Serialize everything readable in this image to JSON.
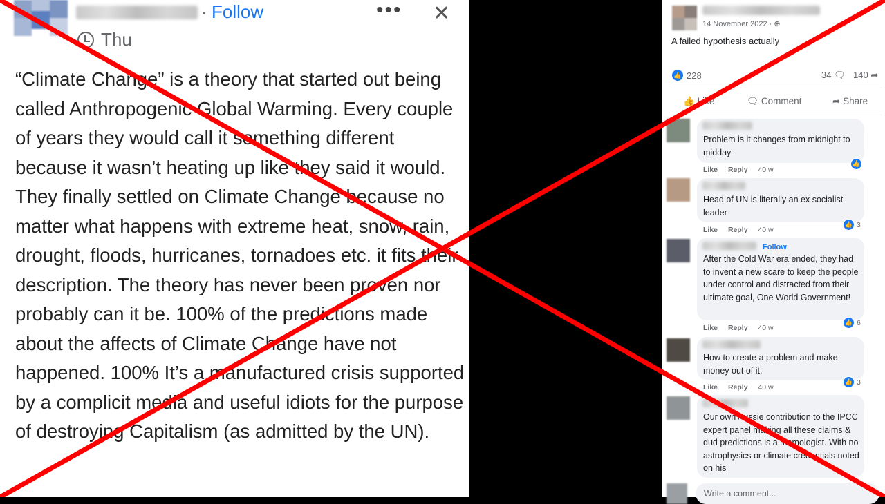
{
  "left_post": {
    "follow_label": "Follow",
    "separator": "·",
    "more_icon": "•••",
    "close_icon": "✕",
    "timestamp": "Thu",
    "body": "“Climate Change” is a theory that started out being called Anthropogenic Global Warming. Every couple of years they would call it something different because it wasn’t heating up like they said it would. They finally settled on Climate Change because no matter what happens with extreme heat, snow, rain, drought, floods, hurricanes, tornadoes etc. it fits their description. The theory has never been proven nor probably can it be. 100% of the predictions made about the affects of Climate Change have not happened. 100% It’s a manufactured crisis supported by a complicit media and useful idiots for the purpose of destroying Capitalism (as admitted by the UN)."
  },
  "right_post": {
    "date": "14 November 2022 · ⊕",
    "text": "A failed hypothesis actually",
    "likes": "228",
    "comments": "34",
    "shares": "140",
    "actions": {
      "like": "Like",
      "comment": "Comment",
      "share": "Share"
    },
    "comment_list": [
      {
        "text": "Problem is it changes from midnight to midday",
        "like": "Like",
        "reply": "Reply",
        "age": "40 w",
        "reactions": ""
      },
      {
        "text": "Head of UN is literally an ex socialist leader",
        "like": "Like",
        "reply": "Reply",
        "age": "40 w",
        "reactions": "3"
      },
      {
        "follow": "Follow",
        "text": "After the Cold War era ended, they had to invent a new scare to keep the people under control and distracted from their ultimate goal, One World Government!",
        "like": "Like",
        "reply": "Reply",
        "age": "40 w",
        "reactions": "6"
      },
      {
        "text": "How to create a problem and make money out of it.",
        "like": "Like",
        "reply": "Reply",
        "age": "40 w",
        "reactions": "3"
      },
      {
        "text": "Our own Aussie contribution to the IPCC expert panel making all these claims & dud predictions is a mamologist. With no astrophysics or climate credentials noted on his",
        "like": "",
        "reply": "",
        "age": "",
        "reactions": ""
      }
    ],
    "write_placeholder": "Write a comment..."
  },
  "overlay": {
    "cross_color": "#ff0000"
  }
}
